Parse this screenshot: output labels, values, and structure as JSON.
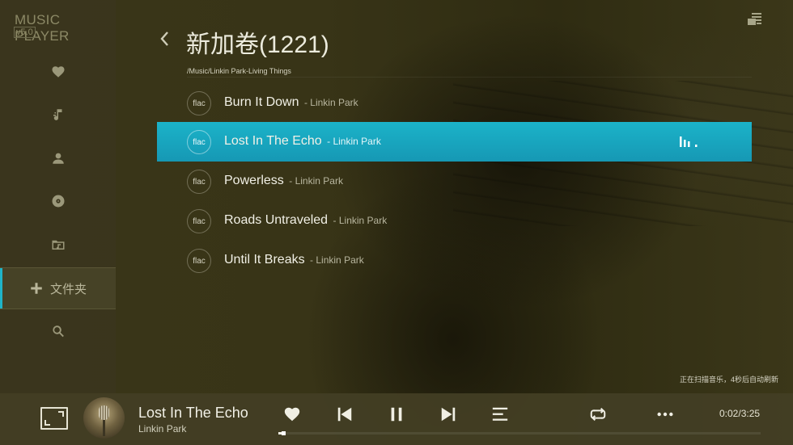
{
  "app": {
    "title": "MUSIC PLAYER",
    "version": "v5.0"
  },
  "sidebar": {
    "items": [
      {
        "icon": "heart-icon",
        "label": ""
      },
      {
        "icon": "music-note-icon",
        "label": ""
      },
      {
        "icon": "person-icon",
        "label": ""
      },
      {
        "icon": "disc-icon",
        "label": ""
      },
      {
        "icon": "folder-music-icon",
        "label": ""
      },
      {
        "icon": "plus-icon",
        "label": "文件夹",
        "active": true
      },
      {
        "icon": "search-icon",
        "label": ""
      }
    ]
  },
  "header": {
    "title": "新加卷(1221)",
    "path": "/Music/Linkin Park-Living Things"
  },
  "tracks": [
    {
      "format": "flac",
      "name": "Burn It Down",
      "artist": "- Linkin Park",
      "selected": false
    },
    {
      "format": "flac",
      "name": "Lost In The Echo",
      "artist": "- Linkin Park",
      "selected": true
    },
    {
      "format": "flac",
      "name": "Powerless",
      "artist": "- Linkin Park",
      "selected": false
    },
    {
      "format": "flac",
      "name": "Roads Untraveled",
      "artist": "- Linkin Park",
      "selected": false
    },
    {
      "format": "flac",
      "name": "Until It Breaks",
      "artist": "- Linkin Park",
      "selected": false
    }
  ],
  "status": {
    "scan_text": "正在扫描音乐，4秒后自动刷新"
  },
  "player": {
    "now_playing_title": "Lost In The Echo",
    "now_playing_artist": "Linkin Park",
    "time": "0:02/3:25",
    "progress_fraction": 0.01,
    "controls": [
      "heart-icon",
      "previous-icon",
      "pause-icon",
      "next-icon",
      "playlist-icon",
      "repeat-icon",
      "more-icon"
    ]
  },
  "colors": {
    "accent": "#1bb3c9",
    "sidebar_active_bar": "#1fb4c8"
  }
}
